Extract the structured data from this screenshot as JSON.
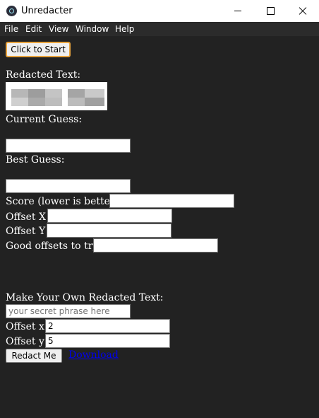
{
  "window": {
    "title": "Unredacter"
  },
  "menu": [
    "File",
    "Edit",
    "View",
    "Window",
    "Help"
  ],
  "toolbar": {
    "start_label": "Click to Start"
  },
  "labels": {
    "redacted_text": "Redacted Text:",
    "current_guess": "Current Guess:",
    "best_guess": "Best Guess:",
    "score": "Score (lower is better)",
    "offset_x": "Offset X",
    "offset_y": "Offset Y",
    "good_offsets": "Good offsets to try",
    "make_own": "Make Your Own Redacted Text:",
    "own_offset_x": "Offset x",
    "own_offset_y": "Offset y"
  },
  "inputs": {
    "current_guess": "",
    "best_guess": "",
    "score": "",
    "offset_x": "",
    "offset_y": "",
    "good_offsets": "",
    "secret_placeholder": "your secret phrase here",
    "own_offset_x": "2",
    "own_offset_y": "5"
  },
  "actions": {
    "redact_label": "Redact Me",
    "download_label": "Download"
  },
  "colors": {
    "background": "#222222",
    "accent_border": "#e8a33d",
    "link": "#0000ee"
  }
}
